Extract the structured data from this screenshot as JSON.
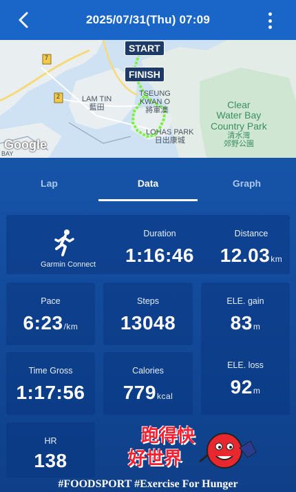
{
  "header": {
    "title": "2025/07/31(Thu) 07:09"
  },
  "map": {
    "start_label": "START",
    "finish_label": "FINISH",
    "places": {
      "lam_tin_en": "LAM TIN",
      "lam_tin_cn": "藍田",
      "tko_en_1": "TSEUNG",
      "tko_en_2": "KWAN O",
      "tko_cn": "將軍澳",
      "lohas_en": "LOHAS PARK",
      "lohas_cn": "日出康城",
      "clear_water_1": "Clear",
      "clear_water_2": "Water Bay",
      "clear_water_3": "Country Park",
      "clear_water_cn_1": "清水灣",
      "clear_water_cn_2": "郊野公園",
      "road_7": "7",
      "road_2": "2",
      "bay_label": "BAY"
    },
    "google_label": "Google"
  },
  "tabs": [
    {
      "label": "Lap"
    },
    {
      "label": "Data"
    },
    {
      "label": "Graph"
    }
  ],
  "stats": {
    "garmin_label": "Garmin Connect",
    "duration": {
      "label": "Duration",
      "value": "1:16:46"
    },
    "distance": {
      "label": "Distance",
      "value": "12.03",
      "unit": "km"
    },
    "pace": {
      "label": "Pace",
      "value": "6:23",
      "unit": "/km"
    },
    "steps": {
      "label": "Steps",
      "value": "13048"
    },
    "ele_gain": {
      "label": "ELE. gain",
      "value": "83",
      "unit": "m"
    },
    "time_gross": {
      "label": "Time Gross",
      "value": "1:17:56"
    },
    "calories": {
      "label": "Calories",
      "value": "779",
      "unit": "kcal"
    },
    "ele_loss": {
      "label": "ELE. loss",
      "value": "92",
      "unit": "m"
    },
    "hr": {
      "label": "HR",
      "value": "138"
    }
  },
  "promo": {
    "cn_line1": "跑得快",
    "cn_line2": "好世界",
    "hashtag": "#FOODSPORT #Exercise For Hunger"
  },
  "colors": {
    "header_bg": "#1a66c8",
    "card_bg": "#0a3782",
    "route": "#7cf04a",
    "promo_red": "#ff1f2f"
  }
}
